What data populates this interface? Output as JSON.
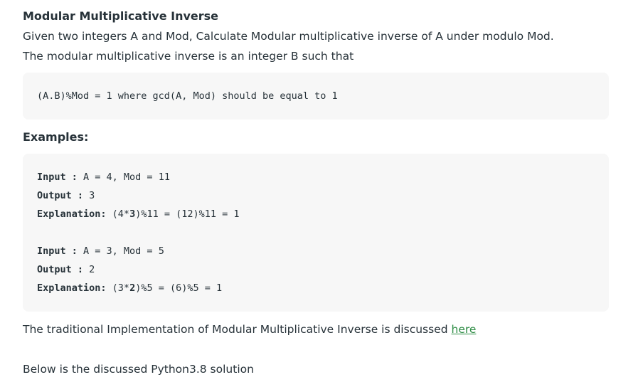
{
  "article": {
    "title": "Modular Multiplicative Inverse",
    "intro_line1": "Given two integers A and Mod, Calculate Modular multiplicative inverse of A under modulo Mod.",
    "intro_line2": "The modular multiplicative inverse is an integer B such that",
    "formula": "(A.B)%Mod = 1 where gcd(A, Mod) should be equal to 1",
    "examples_heading": "Examples:",
    "examples": [
      {
        "input_label": "Input",
        "input_sep": " : ",
        "input_value": "A = 4, Mod = 11",
        "output_label": "Output",
        "output_sep": " : ",
        "output_value": "3",
        "explanation_label": "Explanation:",
        "expl_pre": " (4*",
        "expl_bold": "3",
        "expl_post": ")%11 = (12)%11 = 1"
      },
      {
        "input_label": "Input",
        "input_sep": " : ",
        "input_value": "A = 3, Mod = 5",
        "output_label": "Output",
        "output_sep": " : ",
        "output_value": "2",
        "explanation_label": "Explanation:",
        "expl_pre": " (3*",
        "expl_bold": "2",
        "expl_post": ")%5 = (6)%5 = 1"
      }
    ],
    "traditional_text": "The traditional Implementation of Modular Multiplicative Inverse is discussed ",
    "traditional_link": "here",
    "below_text": "Below is the discussed Python3.8 solution"
  },
  "colors": {
    "text": "#273239",
    "code_bg": "#f7f7f7",
    "link": "#2f8d46"
  }
}
